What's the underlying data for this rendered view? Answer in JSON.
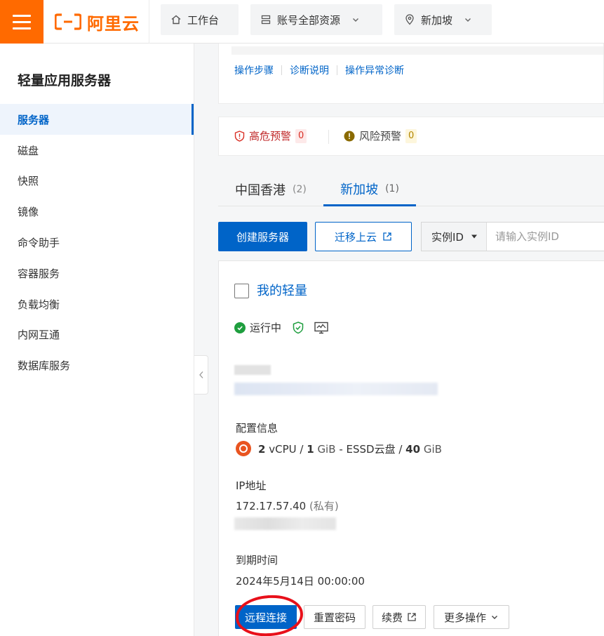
{
  "topbar": {
    "logo_text": "阿里云",
    "workbench_label": "工作台",
    "resources_label": "账号全部资源",
    "region_label": "新加坡"
  },
  "sidebar": {
    "title": "轻量应用服务器",
    "items": [
      {
        "label": "服务器",
        "active": true
      },
      {
        "label": "磁盘"
      },
      {
        "label": "快照"
      },
      {
        "label": "镜像"
      },
      {
        "label": "命令助手"
      },
      {
        "label": "容器服务"
      },
      {
        "label": "负载均衡"
      },
      {
        "label": "内网互通"
      },
      {
        "label": "数据库服务"
      }
    ]
  },
  "diagnosis_links": {
    "steps": "操作步骤",
    "explain": "诊断说明",
    "abnormal": "操作异常诊断"
  },
  "alerts": {
    "high_label": "高危预警",
    "high_count": "0",
    "risk_label": "风险预警",
    "risk_count": "0"
  },
  "tabs": [
    {
      "label": "中国香港",
      "count": "(2)"
    },
    {
      "label": "新加坡",
      "count": "(1)",
      "active": true
    }
  ],
  "toolbar": {
    "create_label": "创建服务器",
    "migrate_label": "迁移上云",
    "search_select": "实例ID",
    "search_placeholder": "请输入实例ID"
  },
  "server": {
    "name": "我的轻量",
    "status": "运行中",
    "config_label": "配置信息",
    "cpu_value": "2",
    "cpu_unit": "vCPU",
    "sep": "/",
    "mem_value": "1",
    "mem_unit": "GiB",
    "disk_type": "- ESSD云盘 /",
    "disk_value": "40",
    "disk_unit": "GiB",
    "ip_label": "IP地址",
    "ip_value": "172.17.57.40",
    "ip_type": "(私有)",
    "expire_label": "到期时间",
    "expire_value": "2024年5月14日 00:00:00",
    "actions": {
      "remote": "远程连接",
      "reset": "重置密码",
      "renew": "续费",
      "more": "更多操作"
    }
  },
  "colors": {
    "brand_orange": "#ff6a00",
    "primary_blue": "#0064c8",
    "success_green": "#1e9e3e",
    "danger_red": "#d93026"
  }
}
